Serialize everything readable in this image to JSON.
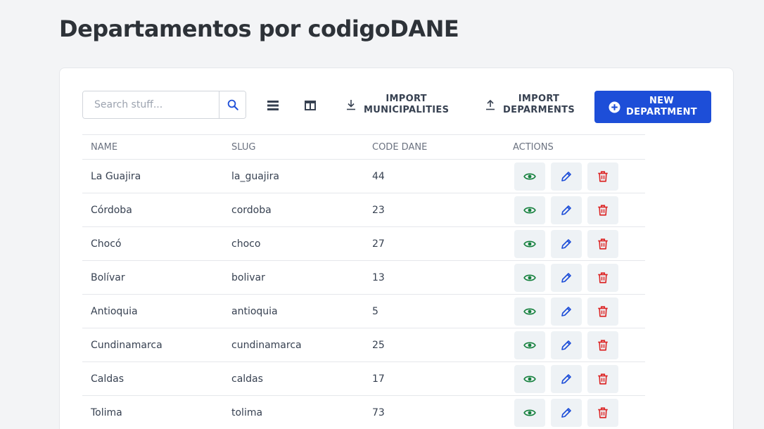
{
  "page": {
    "title": "Departamentos por codigoDANE"
  },
  "toolbar": {
    "search_placeholder": "Search stuff...",
    "search_icon": "search-icon",
    "view_list_icon": "list-view-icon",
    "view_columns_icon": "columns-view-icon",
    "import_municipalities": {
      "line1": "IMPORT",
      "line2": "MUNICIPALITIES",
      "icon": "download-icon"
    },
    "import_departments": {
      "line1": "IMPORT",
      "line2": "DEPARMENTS",
      "icon": "upload-icon"
    },
    "new_department": {
      "line1": "NEW",
      "line2": "DEPARTMENT",
      "icon": "plus-circle-icon"
    }
  },
  "table": {
    "headers": {
      "name": "NAME",
      "slug": "SLUG",
      "code": "CODE DANE",
      "actions": "ACTIONS"
    },
    "rows": [
      {
        "name": "La Guajira",
        "slug": "la_guajira",
        "code": "44"
      },
      {
        "name": "Córdoba",
        "slug": "cordoba",
        "code": "23"
      },
      {
        "name": "Chocó",
        "slug": "choco",
        "code": "27"
      },
      {
        "name": "Bolívar",
        "slug": "bolivar",
        "code": "13"
      },
      {
        "name": "Antioquia",
        "slug": "antioquia",
        "code": "5"
      },
      {
        "name": "Cundinamarca",
        "slug": "cundinamarca",
        "code": "25"
      },
      {
        "name": "Caldas",
        "slug": "caldas",
        "code": "17"
      },
      {
        "name": "Tolima",
        "slug": "tolima",
        "code": "73"
      }
    ],
    "action_icons": {
      "view": "eye-icon",
      "edit": "pencil-icon",
      "delete": "trash-icon"
    }
  },
  "colors": {
    "primary": "#1d4ed8",
    "view": "#15803d",
    "edit": "#1d4ed8",
    "delete": "#dc2626",
    "background": "#f3f4f6"
  }
}
